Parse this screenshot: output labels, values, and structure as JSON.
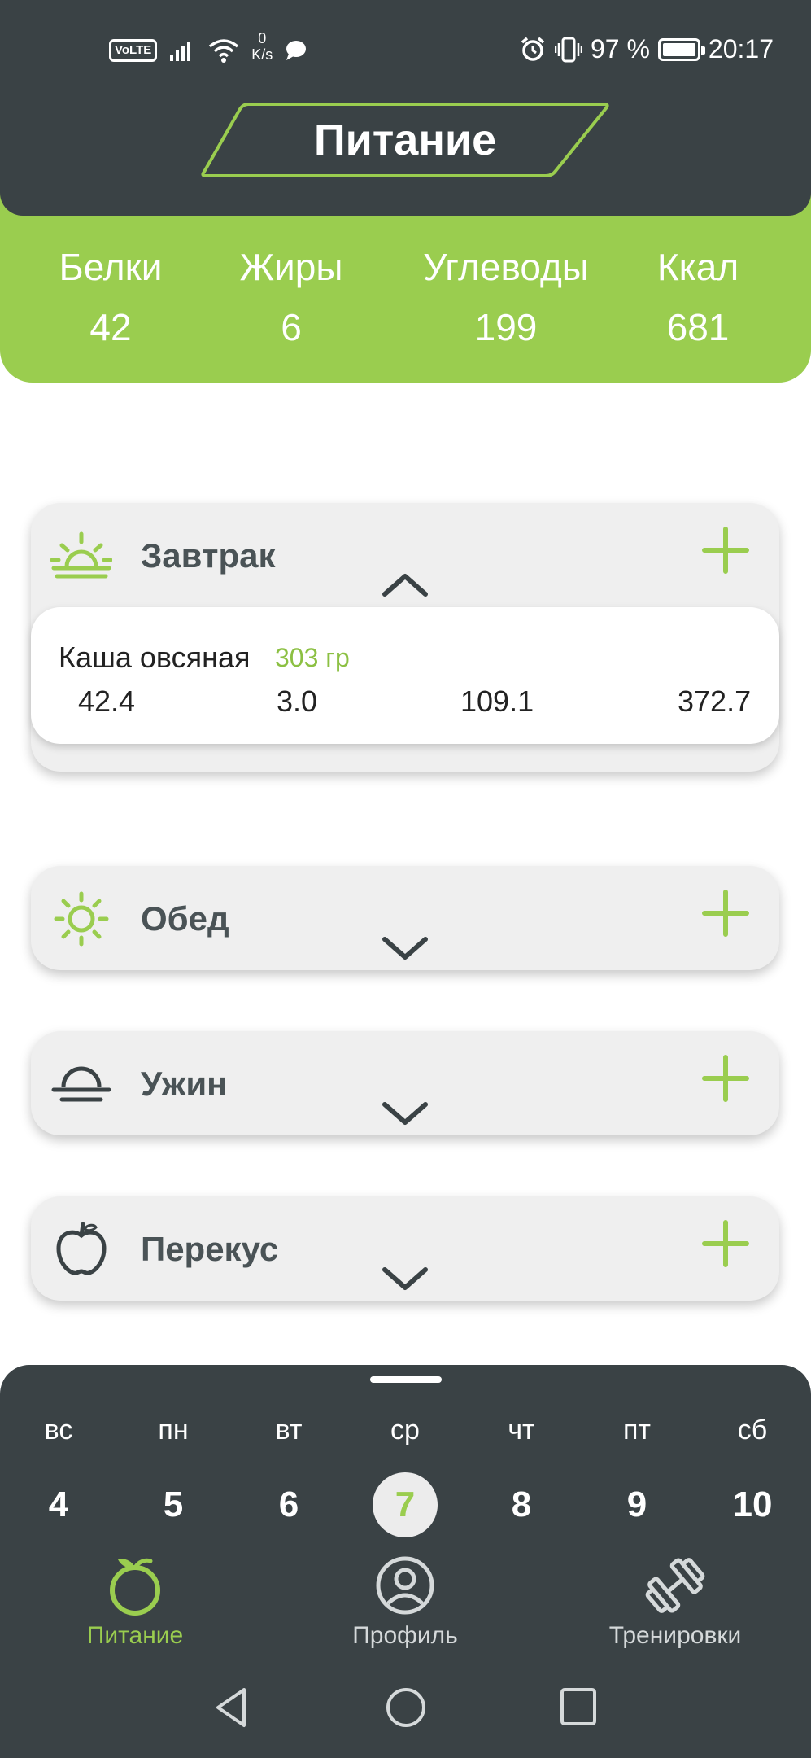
{
  "status_bar": {
    "volte": "VoLTE",
    "speed_value": "0",
    "speed_unit": "K/s",
    "battery": "97 %",
    "time": "20:17"
  },
  "header": {
    "title": "Питание"
  },
  "summary": {
    "protein_label": "Белки",
    "protein_value": "42",
    "fat_label": "Жиры",
    "fat_value": "6",
    "carbs_label": "Углеводы",
    "carbs_value": "199",
    "kcal_label": "Ккал",
    "kcal_value": "681"
  },
  "meals": {
    "breakfast": {
      "name": "Завтрак",
      "expanded": true,
      "items": [
        {
          "name": "Каша овсяная",
          "weight": "303 гр",
          "protein": "42.4",
          "fat": "3.0",
          "carbs": "109.1",
          "kcal": "372.7"
        }
      ]
    },
    "lunch": {
      "name": "Обед"
    },
    "dinner": {
      "name": "Ужин"
    },
    "snack": {
      "name": "Перекус"
    }
  },
  "calendar": {
    "days": [
      {
        "weekday": "вс",
        "date": "4"
      },
      {
        "weekday": "пн",
        "date": "5"
      },
      {
        "weekday": "вт",
        "date": "6"
      },
      {
        "weekday": "ср",
        "date": "7"
      },
      {
        "weekday": "чт",
        "date": "8"
      },
      {
        "weekday": "пт",
        "date": "9"
      },
      {
        "weekday": "сб",
        "date": "10"
      }
    ],
    "selected_date": "7"
  },
  "bottom_nav": {
    "nutrition": "Питание",
    "profile": "Профиль",
    "workouts": "Тренировки"
  },
  "colors": {
    "accent_green": "#9acd4f",
    "dark": "#3a4245",
    "card_bg": "#efefef"
  }
}
